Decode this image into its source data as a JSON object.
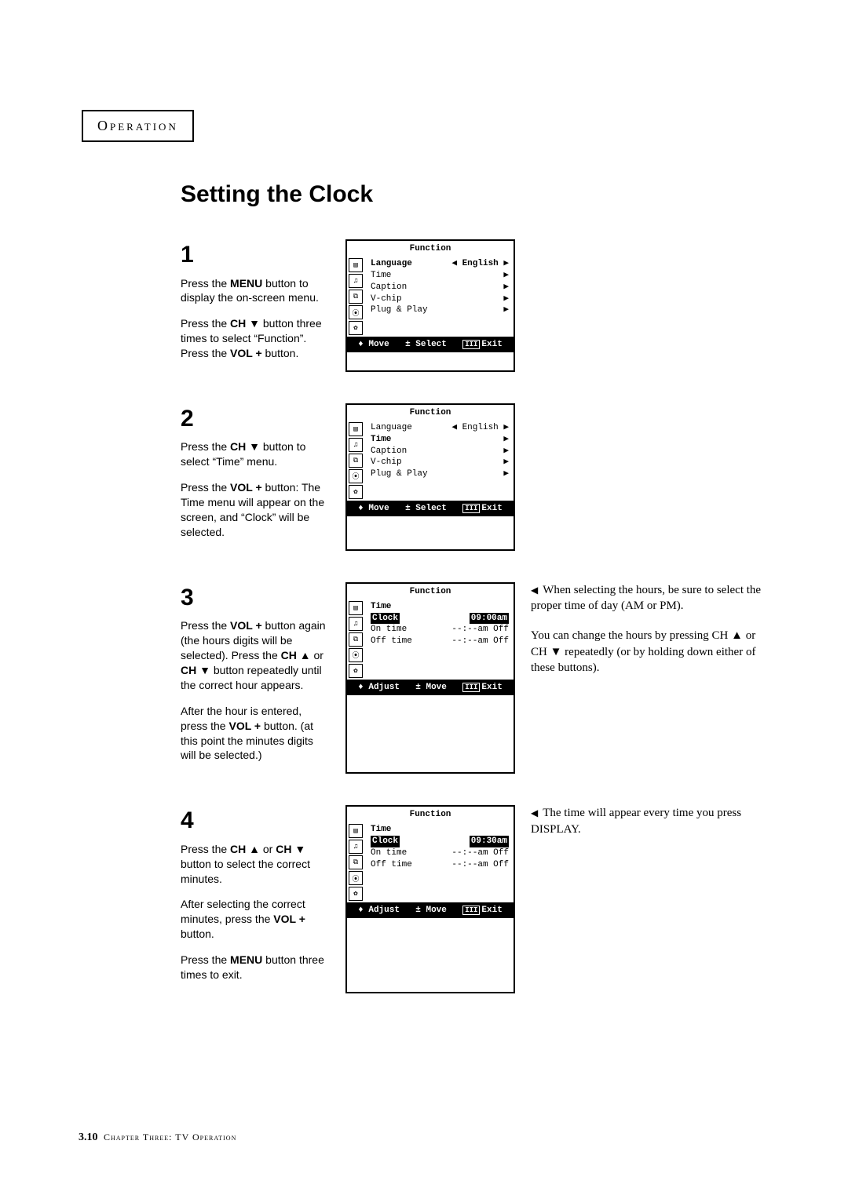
{
  "chapter": "Operation",
  "title": "Setting the Clock",
  "steps": [
    {
      "num": "1",
      "paras": [
        "Press the <b>MENU</b> button to display the on-screen menu.",
        "Press the <b>CH ▼</b> button three times to select “Function”.<br>Press the <b>VOL +</b> button."
      ],
      "osd": {
        "title": "Function",
        "rows": [
          {
            "lab": "Language",
            "val": "◀ English ▶",
            "hi": true
          },
          {
            "lab": "Time",
            "val": "▶"
          },
          {
            "lab": "Caption",
            "val": "▶"
          },
          {
            "lab": "V-chip",
            "val": "▶"
          },
          {
            "lab": "Plug & Play",
            "val": "▶"
          }
        ],
        "footer": [
          "♦ Move",
          "± Select",
          "▯▯ Exit"
        ]
      }
    },
    {
      "num": "2",
      "paras": [
        "Press the <b>CH ▼</b> button to select “Time” menu.",
        "Press the <b>VOL +</b> button: The Time menu will appear on the screen, and “Clock” will be selected."
      ],
      "osd": {
        "title": "Function",
        "rows": [
          {
            "lab": "Language",
            "val": "◀ English ▶"
          },
          {
            "lab": "Time",
            "val": "▶",
            "hi": true
          },
          {
            "lab": "Caption",
            "val": "▶"
          },
          {
            "lab": "V-chip",
            "val": "▶"
          },
          {
            "lab": "Plug & Play",
            "val": "▶"
          }
        ],
        "footer": [
          "♦ Move",
          "± Select",
          "▯▯ Exit"
        ]
      }
    },
    {
      "num": "3",
      "paras": [
        "Press the <b>VOL +</b> button again (the hours digits will be selected). Press the <b>CH ▲</b> or <b>CH ▼</b> button repeatedly until the correct hour appears.",
        "After the hour is entered, press the <b>VOL +</b> button. (at this point the minutes digits will be selected.)"
      ],
      "osd": {
        "title": "Function",
        "rows": [
          {
            "lab": "Time",
            "val": "",
            "hi": true
          },
          {
            "lab": "Clock",
            "val": "09:00am",
            "sel": true,
            "hi": true
          },
          {
            "lab": "On time",
            "val": "--:--am Off"
          },
          {
            "lab": "Off time",
            "val": "--:--am Off"
          }
        ],
        "footer": [
          "♦ Adjust",
          "± Move",
          "▯▯ Exit"
        ]
      },
      "notes": [
        "When selecting the hours, be sure to select the proper time of day (AM or PM).",
        "You can change the hours by pressing CH ▲ or CH ▼ repeatedly (or by holding down either of these buttons)."
      ],
      "notes_lead_tri": [
        true,
        false
      ]
    },
    {
      "num": "4",
      "paras": [
        "Press the <b>CH ▲</b> or <b>CH ▼</b> button to select the correct minutes.",
        "After selecting the correct minutes, press the <b>VOL +</b> button.",
        "Press the <b>MENU</b> button three times to exit."
      ],
      "osd": {
        "title": "Function",
        "rows": [
          {
            "lab": "Time",
            "val": "",
            "hi": true
          },
          {
            "lab": "Clock",
            "val": "09:30am",
            "sel": true,
            "hi": true
          },
          {
            "lab": "On time",
            "val": "--:--am Off"
          },
          {
            "lab": "Off time",
            "val": "--:--am Off"
          }
        ],
        "footer": [
          "♦ Adjust",
          "± Move",
          "▯▯ Exit"
        ]
      },
      "notes": [
        "The time will appear every time you press DISPLAY."
      ],
      "notes_lead_tri": [
        true
      ]
    }
  ],
  "icons": [
    "▤",
    "♫",
    "⧉",
    "⦿",
    "✿"
  ],
  "footer": {
    "page": "3.10",
    "chapter": "Chapter Three: TV Operation"
  }
}
